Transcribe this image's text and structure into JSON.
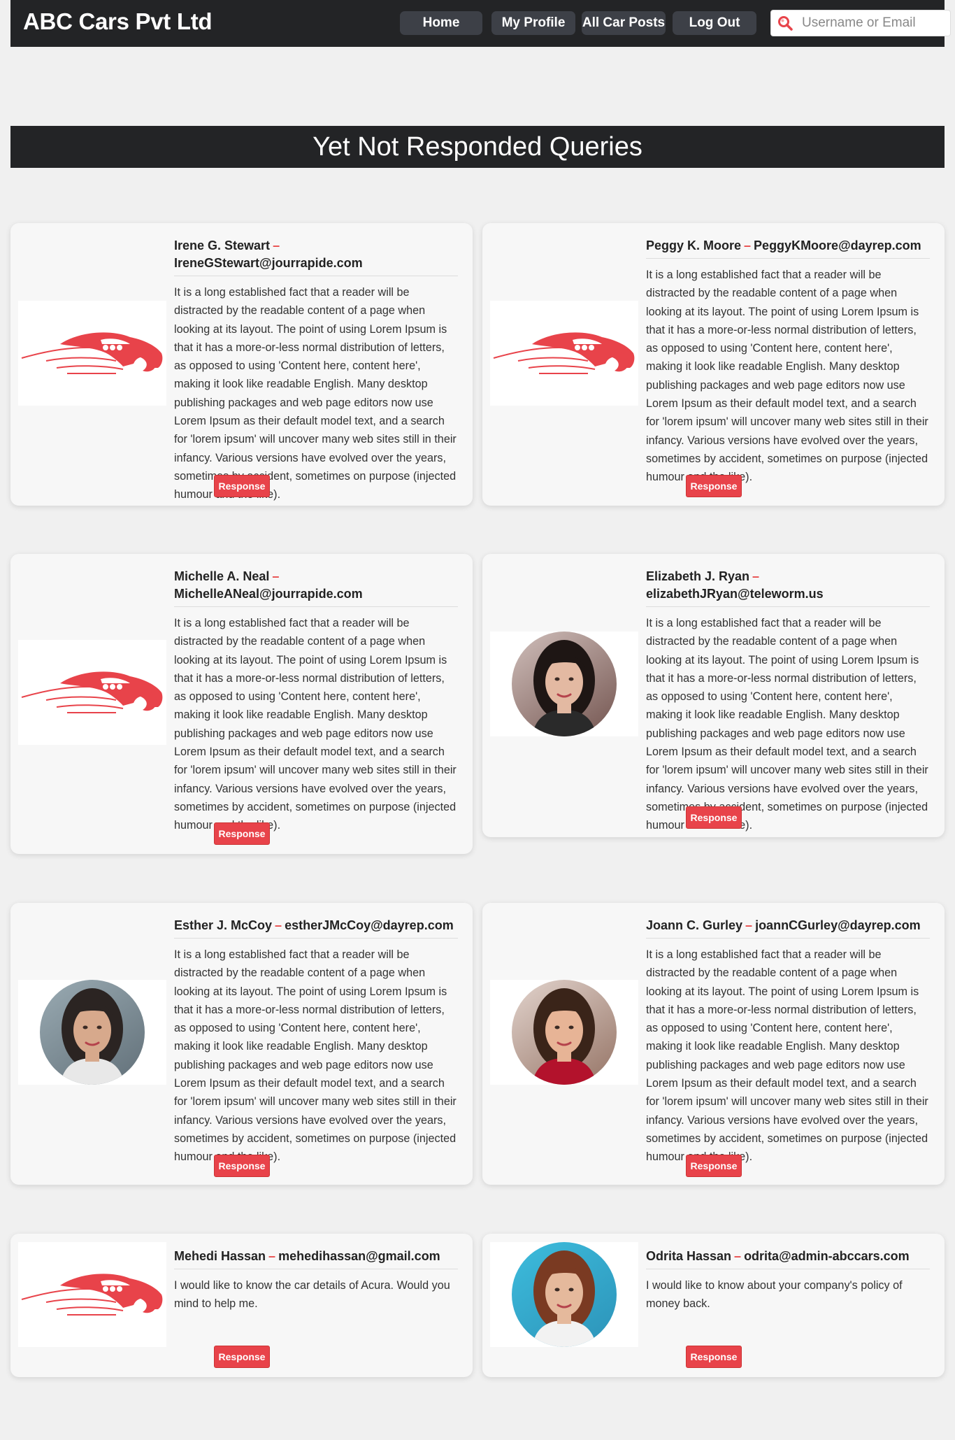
{
  "navbar": {
    "brand": "ABC Cars Pvt Ltd",
    "links": [
      "Home",
      "My Profile",
      "All Car Posts",
      "Log Out"
    ],
    "search_placeholder": "Username or Email"
  },
  "page_title": "Yet Not Responded Queries",
  "response_label": "Response",
  "colors": {
    "accent": "#e8434a",
    "dark": "#232426"
  },
  "queries": [
    {
      "name": "Irene G. Stewart",
      "email": "IreneGStewart@jourrapide.com",
      "avatar": "car-logo",
      "message": "It is a long established fact that a reader will be distracted by the readable content of a page when looking at its layout. The point of using Lorem Ipsum is that it has a more-or-less normal distribution of letters, as opposed to using 'Content here, content here', making it look like readable English. Many desktop publishing packages and web page editors now use Lorem Ipsum as their default model text, and a search for 'lorem ipsum' will uncover many web sites still in their infancy. Various versions have evolved over the years, sometimes by accident, sometimes on purpose (injected humour and the like)."
    },
    {
      "name": "Peggy K. Moore",
      "email": "PeggyKMoore@dayrep.com",
      "avatar": "car-logo",
      "message": "It is a long established fact that a reader will be distracted by the readable content of a page when looking at its layout. The point of using Lorem Ipsum is that it has a more-or-less normal distribution of letters, as opposed to using 'Content here, content here', making it look like readable English. Many desktop publishing packages and web page editors now use Lorem Ipsum as their default model text, and a search for 'lorem ipsum' will uncover many web sites still in their infancy. Various versions have evolved over the years, sometimes by accident, sometimes on purpose (injected humour and the like)."
    },
    {
      "name": "Michelle A. Neal",
      "email": "MichelleANeal@jourrapide.com",
      "avatar": "car-logo",
      "message": "It is a long established fact that a reader will be distracted by the readable content of a page when looking at its layout. The point of using Lorem Ipsum is that it has a more-or-less normal distribution of letters, as opposed to using 'Content here, content here', making it look like readable English. Many desktop publishing packages and web page editors now use Lorem Ipsum as their default model text, and a search for 'lorem ipsum' will uncover many web sites still in their infancy. Various versions have evolved over the years, sometimes by accident, sometimes on purpose (injected humour and the like)."
    },
    {
      "name": "Elizabeth J. Ryan",
      "email": "elizabethJRyan@teleworm.us",
      "avatar": "photo-woman-dark-hair",
      "message": "It is a long established fact that a reader will be distracted by the readable content of a page when looking at its layout. The point of using Lorem Ipsum is that it has a more-or-less normal distribution of letters, as opposed to using 'Content here, content here', making it look like readable English. Many desktop publishing packages and web page editors now use Lorem Ipsum as their default model text, and a search for 'lorem ipsum' will uncover many web sites still in their infancy. Various versions have evolved over the years, sometimes by accident, sometimes on purpose (injected humour and the like)."
    },
    {
      "name": "Esther J. McCoy",
      "email": "estherJMcCoy@dayrep.com",
      "avatar": "photo-woman-glasses",
      "message": "It is a long established fact that a reader will be distracted by the readable content of a page when looking at its layout. The point of using Lorem Ipsum is that it has a more-or-less normal distribution of letters, as opposed to using 'Content here, content here', making it look like readable English. Many desktop publishing packages and web page editors now use Lorem Ipsum as their default model text, and a search for 'lorem ipsum' will uncover many web sites still in their infancy. Various versions have evolved over the years, sometimes by accident, sometimes on purpose (injected humour and the like)."
    },
    {
      "name": "Joann C. Gurley",
      "email": "joannCGurley@dayrep.com",
      "avatar": "photo-woman-smiling",
      "message": "It is a long established fact that a reader will be distracted by the readable content of a page when looking at its layout. The point of using Lorem Ipsum is that it has a more-or-less normal distribution of letters, as opposed to using 'Content here, content here', making it look like readable English. Many desktop publishing packages and web page editors now use Lorem Ipsum as their default model text, and a search for 'lorem ipsum' will uncover many web sites still in their infancy. Various versions have evolved over the years, sometimes by accident, sometimes on purpose (injected humour and the like)."
    },
    {
      "name": "Mehedi Hassan",
      "email": "mehedihassan@gmail.com",
      "avatar": "car-logo",
      "message": "I would like to know the car details of Acura. Would you mind to help me."
    },
    {
      "name": "Odrita Hassan",
      "email": "odrita@admin-abccars.com",
      "avatar": "photo-woman-auburn-hair",
      "message": "I would like to know about your company's policy of money back."
    }
  ]
}
